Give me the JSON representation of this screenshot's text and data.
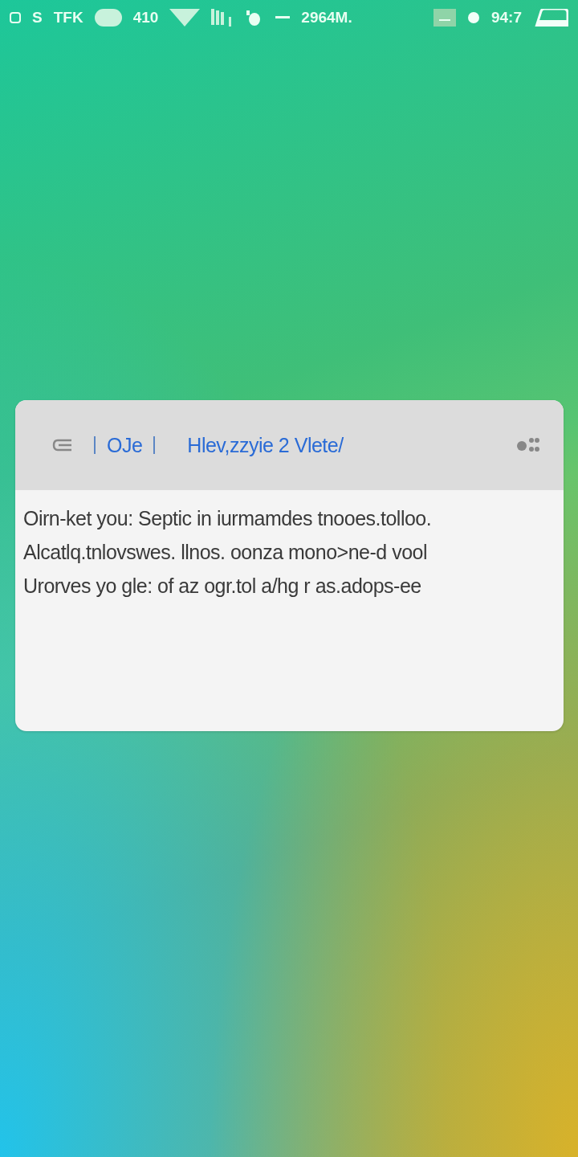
{
  "status_bar": {
    "left_texts": [
      "S",
      "TFK",
      "410",
      "2964M."
    ],
    "time": "94:7"
  },
  "card": {
    "header": {
      "tab_label": "OJe",
      "title": "Hlev,zzyie 2 Vlete/"
    },
    "lines": [
      "Oirn-ket you: Septic in iurmamdes tnooes.tolloo.",
      "Alcatlq.tnlovswes. llnos. oonza mono>ne-d vool",
      "Urorves yo gle: of az ogr.tol a/hg r as.adops-ee"
    ]
  }
}
